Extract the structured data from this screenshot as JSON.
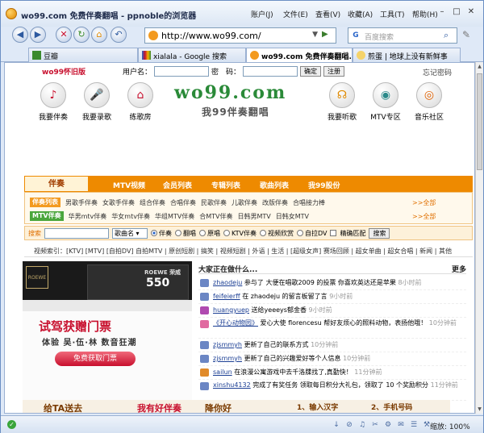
{
  "window": {
    "title": "wo99.com 免费伴奏翻唱 - ppnoble的浏览器",
    "menu": [
      "账户(J)",
      "文件(E)",
      "查看(V)",
      "收藏(A)",
      "工具(T)",
      "帮助(H)"
    ]
  },
  "nav": {
    "address": "http://www.wo99.com/",
    "search_placeholder": "百度搜索"
  },
  "tabs": [
    {
      "label": "豆瓣",
      "active": false
    },
    {
      "label": "xialala - Google 搜索",
      "active": false
    },
    {
      "label": "wo99.com 免费伴奏翻唱...",
      "active": true
    },
    {
      "label": "煎蛋 | 地球上没有新鲜事",
      "active": false
    }
  ],
  "page": {
    "old_version": "wo99怀旧版",
    "login": {
      "user_label": "用户名：",
      "pass_label": "密　码：",
      "ok": "确定",
      "register": "注册",
      "forgot": "忘记密码"
    },
    "icons_left": [
      "我要伴奏",
      "我要录歌",
      "练歌房"
    ],
    "icons_right": [
      "我要听歌",
      "MTV专区",
      "音乐社区"
    ],
    "brand": "wo99.com",
    "slogan": "我99伴奏翻唱",
    "band": {
      "first": "伴奏",
      "items": [
        "MTV视频",
        "会员列表",
        "专辑列表",
        "歌曲列表",
        "我99股份"
      ]
    },
    "cats": [
      {
        "tag": "伴奏列表",
        "items": [
          "男歌手伴奏",
          "女歌手伴奏",
          "组合伴奏",
          "合唱伴奏",
          "民歌伴奏",
          "儿歌伴奏",
          "改版伴奏",
          "合唱接力棒"
        ],
        "more": ">>全部"
      },
      {
        "tag": "MTV伴奏",
        "items": [
          "华男mtv伴奏",
          "华女mtv伴奏",
          "华组MTV伴奏",
          "合MTV伴奏",
          "日韩男MTV",
          "日韩女MTV"
        ],
        "more": ">>全部"
      }
    ],
    "search": {
      "label": "搜索",
      "select": "歌曲名",
      "options": [
        "伴奏",
        "翻唱",
        "原唱",
        "KTV伴奏",
        "视频欣赏",
        "自拉DV"
      ],
      "exact": "精确匹配",
      "button": "搜索"
    },
    "video_index": "视频索引：[KTV] [MTV] [自拍DV] 自拍MTV | 原创短剧 | 搞笑 | 视频短剧 | 外语 | 生活 | [超级女声] 赛场回顾 | 超女单曲 | 超女合唱 | 新闻 | 其他",
    "ad": {
      "brand": "ROEWE",
      "model_brand": "ROEWE 荣威",
      "model": "550",
      "headline": "试驾获赠门票",
      "sub": "体验 吴·伍·林 数音狂潮",
      "button": "免费获取门票"
    },
    "feed": {
      "header": "大家正在做什么...",
      "more": "更多",
      "rows": [
        {
          "user": "zhaodeju",
          "text": "参与了 大便在唱歌2009 的投票 你喜欢英达还是苹果",
          "time": "8小时前",
          "color": "#6b86c4"
        },
        {
          "user": "feifeierff",
          "text": "在 zhaodeju 的留言板留了言",
          "time": "9小时前",
          "color": "#6b86c4"
        },
        {
          "user": "huangyuep",
          "text": "送给yeeeys郁金香",
          "time": "9小时前",
          "color": "#b04ab0"
        },
        {
          "user": "《开心动物园》",
          "text": "爱心大使 florencesu 帮好友烦心的照料动物，表扬他哦！",
          "time": "10分钟前",
          "color": "#e06aa0",
          "tall": true
        },
        {
          "user": "zjsmmyh",
          "text": "更新了自己的联系方式",
          "time": "10分钟前",
          "color": "#6b86c4"
        },
        {
          "user": "zjsmmyh",
          "text": "更新了自己的兴趣爱好等个人信息",
          "time": "10分钟前",
          "color": "#6b86c4"
        },
        {
          "user": "sailun",
          "text": "在浪漫公寓游戏中去千洛牒找了,真勤快！",
          "time": "11分钟前",
          "color": "#e08a2a"
        },
        {
          "user": "xinshu4132",
          "text": "完成了有奖任务 领取每日积分大礼包，领取了 10 个奖励积分",
          "time": "11分钟前",
          "color": "#6b86c4",
          "tall": true
        }
      ]
    },
    "bottom_strip": [
      "给TA送去",
      "我有好伴奏",
      "降你好",
      "1、输入汉字",
      "2、手机号码"
    ]
  },
  "status": {
    "zoom": "缩放: 100%"
  }
}
